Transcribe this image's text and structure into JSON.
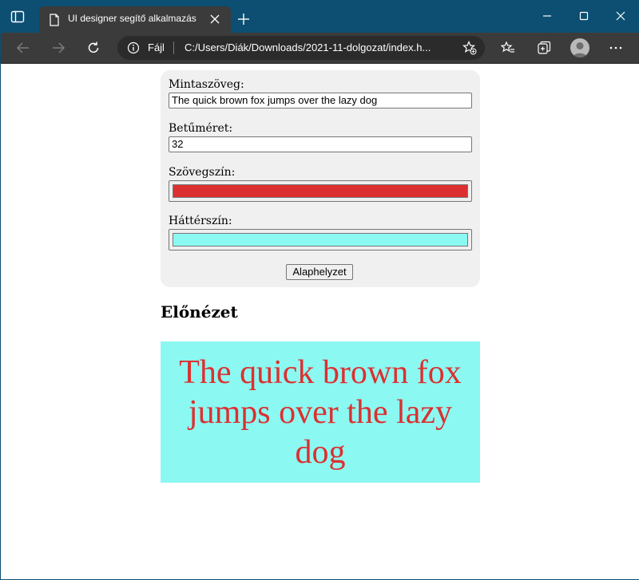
{
  "browser": {
    "tab_title": "UI designer segítő alkalmazás",
    "address_label": "Fájl",
    "url": "C:/Users/Diák/Downloads/2021-11-dolgozat/index.h..."
  },
  "form": {
    "sample_label": "Mintaszöveg:",
    "sample_value": "The quick brown fox jumps over the lazy dog",
    "size_label": "Betűméret:",
    "size_value": "32",
    "text_color_label": "Szövegszín:",
    "text_color": "#dc3030",
    "bg_color_label": "Háttérszín:",
    "bg_color": "#8cf8f2",
    "reset_label": "Alaphelyzet"
  },
  "preview": {
    "heading": "Előnézet",
    "text": "The quick brown fox jumps over the lazy dog"
  },
  "colors": {
    "titlebar": "#0c4f72",
    "toolbar": "#3b3b3b",
    "panel_bg": "#f0f0f0"
  }
}
